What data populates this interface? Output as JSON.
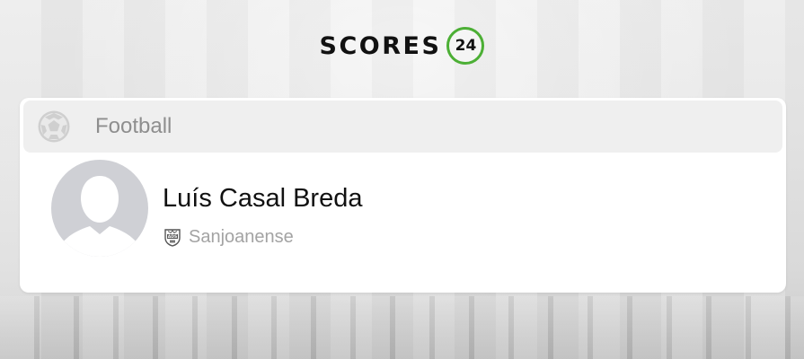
{
  "brand": {
    "logo_text": "SCORES",
    "logo_number": "24",
    "accent_color": "#4caf35"
  },
  "section": {
    "sport_label": "Football",
    "sport_icon": "soccer-ball-icon"
  },
  "player": {
    "name": "Luís Casal Breda",
    "avatar_icon": "avatar-placeholder-icon",
    "team": {
      "name": "Sanjoanense",
      "badge_icon": "team-crest-icon",
      "badge_text": "ADS"
    }
  }
}
